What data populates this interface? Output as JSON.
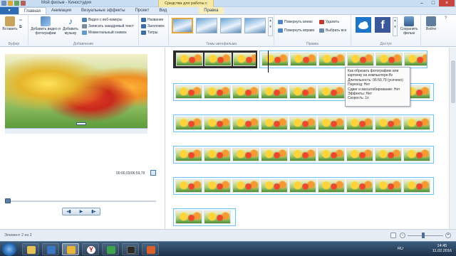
{
  "window": {
    "title": "Мой фильм - Киностудия",
    "context_tab": "Средства для работы с видео"
  },
  "tabs": {
    "file": "",
    "items": [
      "Главная",
      "Анимация",
      "Визуальные эффекты",
      "Проект",
      "Вид",
      "Правка"
    ]
  },
  "ribbon": {
    "paste_label": "Вставить",
    "add_video_label": "Добавить видео и фотографии",
    "add_music_label": "Добавить музыку",
    "webcam_label": "Видео с веб-камеры",
    "narration_label": "Записать закадровый текст",
    "snapshot_label": "Моментальный снимок",
    "title_label": "Название",
    "caption_label": "Заголовок",
    "credits_label": "Титры",
    "rotate_left_label": "Повернуть влево",
    "rotate_right_label": "Повернуть вправо",
    "remove_label": "Удалить",
    "select_all_label": "Выбрать все",
    "save_movie_label": "Сохранить фильм",
    "signin_label": "Войти",
    "groups": {
      "clipboard": "Буфер",
      "add": "Добавление",
      "themes": "Темы автофильма",
      "editing": "Правка",
      "share": "Доступ"
    }
  },
  "preview": {
    "time_readout": "00:00,03/06:59,79"
  },
  "tooltip": {
    "lines": [
      "Как обрезать фотографию или",
      "картинку на компьютере.flv",
      "Длительность: 06:59,79 (усечено)",
      "Переход: Нет",
      "Сдвиг и масштабирование: Нет",
      "Эффекты: Нет",
      "Скорость: 1x"
    ]
  },
  "status": {
    "text": "Элемент 2 из 2"
  },
  "taskbar": {
    "language": "RU",
    "time": "14:45",
    "date": "11.02.2016"
  }
}
